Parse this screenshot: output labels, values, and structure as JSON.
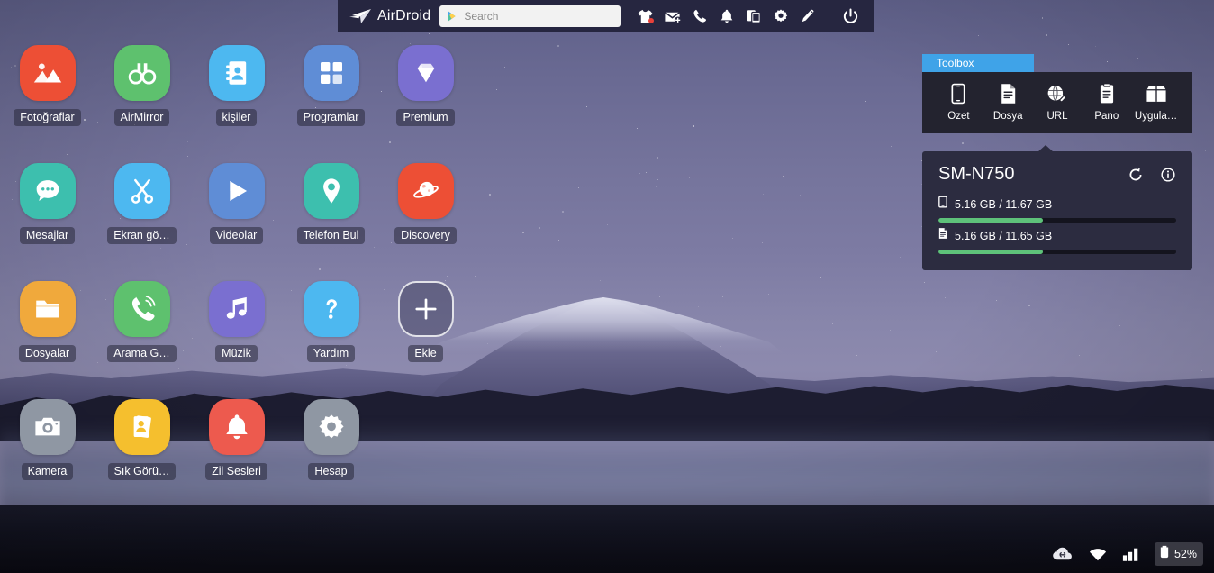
{
  "topbar": {
    "logo_text": "AirDroid",
    "logo_icon": "airdroid-arrow-icon",
    "search": {
      "placeholder": "Search",
      "value": "",
      "icon": "google-play-icon"
    },
    "icons": [
      {
        "name": "tshirt-icon",
        "label": "Themes",
        "badge": true
      },
      {
        "name": "envelope-icon",
        "label": "Messages",
        "badge": false
      },
      {
        "name": "phone-icon",
        "label": "Calls",
        "badge": false
      },
      {
        "name": "bell-icon",
        "label": "Notifications",
        "badge": false
      },
      {
        "name": "devices-icon",
        "label": "Mirror",
        "badge": false
      },
      {
        "name": "gear-icon",
        "label": "Settings",
        "badge": false
      },
      {
        "name": "pencil-icon",
        "label": "Edit",
        "badge": false
      }
    ],
    "power": {
      "name": "power-icon",
      "label": "Power"
    }
  },
  "apps": [
    {
      "label": "Fotoğraflar",
      "icon": "photos-icon",
      "color": "#ed4f35"
    },
    {
      "label": "AirMirror",
      "icon": "binoculars-icon",
      "color": "#5ec16e"
    },
    {
      "label": "kişiler",
      "icon": "contacts-icon",
      "color": "#4db8f0"
    },
    {
      "label": "Programlar",
      "icon": "apps-grid-icon",
      "color": "#5f8dd6"
    },
    {
      "label": "Premium",
      "icon": "diamond-icon",
      "color": "#7a6fd0"
    },
    {
      "label": "Mesajlar",
      "icon": "chat-bubble-icon",
      "color": "#3dbfae"
    },
    {
      "label": "Ekran gö…",
      "icon": "scissors-icon",
      "color": "#4db8f0"
    },
    {
      "label": "Videolar",
      "icon": "play-icon",
      "color": "#5f8dd6"
    },
    {
      "label": "Telefon Bul",
      "icon": "location-pin-icon",
      "color": "#3dbfae"
    },
    {
      "label": "Discovery",
      "icon": "planet-icon",
      "color": "#ed4f35"
    },
    {
      "label": "Dosyalar",
      "icon": "folder-icon",
      "color": "#f0a93c"
    },
    {
      "label": "Arama G…",
      "icon": "call-log-icon",
      "color": "#5ec16e"
    },
    {
      "label": "Müzik",
      "icon": "music-note-icon",
      "color": "#7a6fd0"
    },
    {
      "label": "Yardım",
      "icon": "question-icon",
      "color": "#4db8f0"
    },
    {
      "label": "Ekle",
      "icon": "plus-icon",
      "color": "transparent"
    },
    {
      "label": "Kamera",
      "icon": "camera-icon",
      "color": "#8f97a3"
    },
    {
      "label": "Sık Görü…",
      "icon": "favorites-icon",
      "color": "#f5bf2e"
    },
    {
      "label": "Zil Sesleri",
      "icon": "ringtone-bell-icon",
      "color": "#ed5a4e"
    },
    {
      "label": "Hesap",
      "icon": "account-gear-icon",
      "color": "#8f97a3"
    }
  ],
  "toolbox": {
    "tab_label": "Toolbox",
    "tab_color": "#3fa3e8",
    "items": [
      {
        "label": "Özet",
        "icon": "phone-outline-icon"
      },
      {
        "label": "Dosya",
        "icon": "document-icon"
      },
      {
        "label": "URL",
        "icon": "globe-link-icon"
      },
      {
        "label": "Pano",
        "icon": "clipboard-icon"
      },
      {
        "label": "Uygula…",
        "icon": "package-box-icon"
      }
    ]
  },
  "device": {
    "name": "SM-N750",
    "refresh_icon": "refresh-icon",
    "info_icon": "info-icon",
    "storage": [
      {
        "icon": "phone-storage-icon",
        "text": "5.16 GB / 11.67 GB",
        "percent": 44,
        "bar_color": "#5ec27a"
      },
      {
        "icon": "sdcard-storage-icon",
        "text": "5.16 GB / 11.65 GB",
        "percent": 44,
        "bar_color": "#5ec27a"
      }
    ]
  },
  "statusbar": {
    "items": [
      {
        "name": "cloud-link-icon",
        "label": "Connection"
      },
      {
        "name": "wifi-icon",
        "label": "Wi-Fi"
      },
      {
        "name": "signal-bars-icon",
        "label": "Signal"
      }
    ],
    "battery": {
      "icon": "battery-icon",
      "text": "52%"
    }
  }
}
